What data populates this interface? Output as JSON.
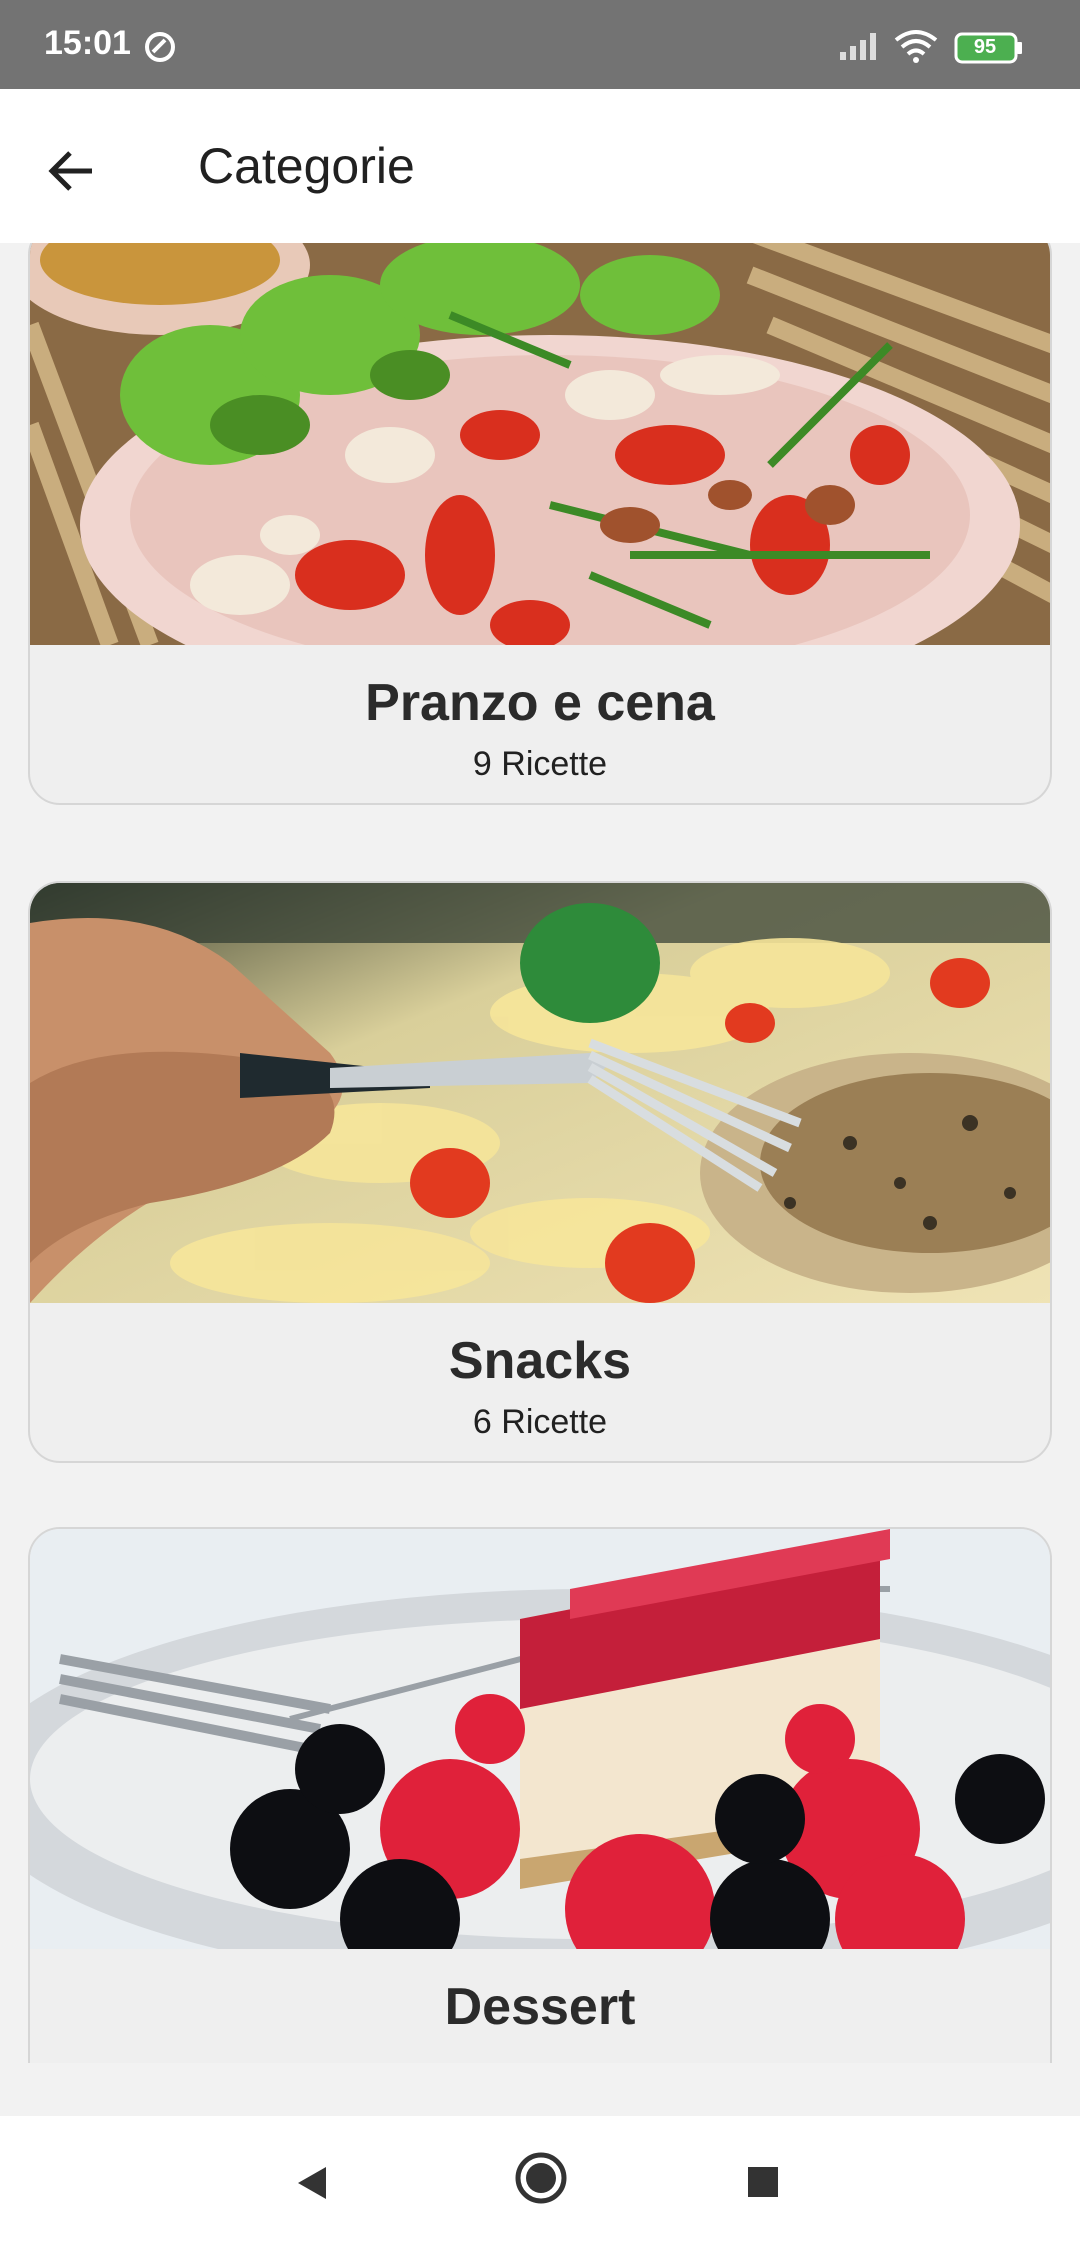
{
  "status_bar": {
    "time": "15:01",
    "battery": "95",
    "icons": [
      "sync-icon",
      "signal-icon",
      "wifi-icon",
      "battery-icon"
    ]
  },
  "app_bar": {
    "title": "Categorie",
    "back_icon": "arrow-left-icon"
  },
  "categories": [
    {
      "name": "Pranzo e cena",
      "count": "9 Ricette",
      "image": "salad-plate-photo"
    },
    {
      "name": "Snacks",
      "count": "6 Ricette",
      "image": "fork-pasta-photo"
    },
    {
      "name": "Dessert",
      "count": "",
      "image": "cheesecake-berries-photo"
    }
  ],
  "nav_bar": {
    "icons": [
      "nav-back-icon",
      "nav-home-icon",
      "nav-recent-icon"
    ]
  },
  "colors": {
    "status_bar": "#737373",
    "app_bar": "#ffffff",
    "background": "#f2f2f2",
    "card": "#efefef",
    "battery_fill": "#4caf50"
  }
}
